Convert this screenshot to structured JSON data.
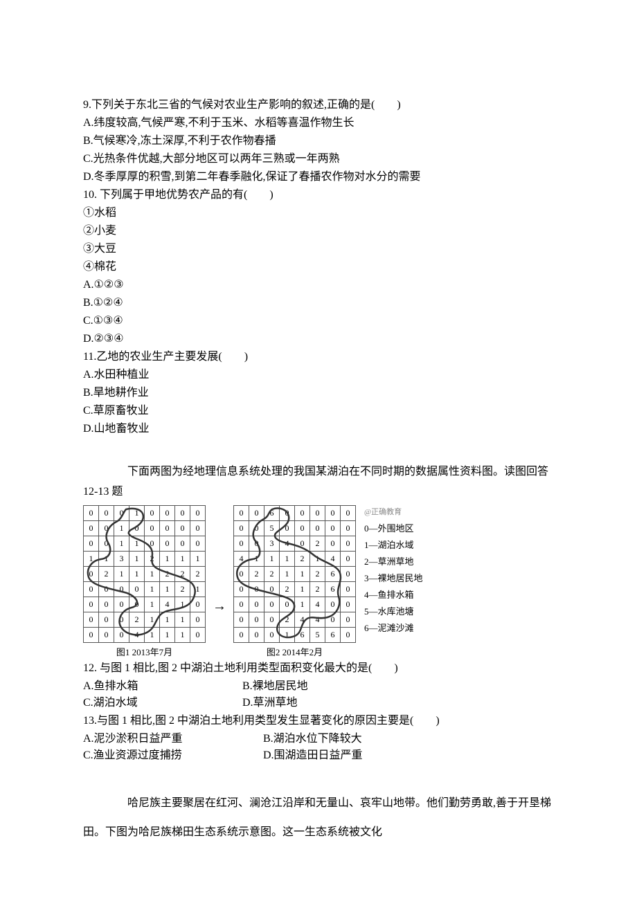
{
  "q9": {
    "stem": "9.下列关于东北三省的气候对农业生产影响的叙述,正确的是(　　)",
    "A": "A.纬度较高,气候严寒,不利于玉米、水稻等喜温作物生长",
    "B": "B.气候寒冷,冻土深厚,不利于农作物春播",
    "C": "C.光热条件优越,大部分地区可以两年三熟或一年两熟",
    "D": "D.冬季厚厚的积雪,到第二年春季融化,保证了春播农作物对水分的需要"
  },
  "q10": {
    "stem": "10. 下列属于甲地优势农产品的有(　　)",
    "i1": "①水稻",
    "i2": "②小麦",
    "i3": "③大豆",
    "i4": "④棉花",
    "A": "A.①②③",
    "B": "B.①②④",
    "C": "C.①③④",
    "D": "D.②③④"
  },
  "q11": {
    "stem": "11.乙地的农业生产主要发展(　　)",
    "A": "A.水田种植业",
    "B": "B.旱地耕作业",
    "C": "C.草原畜牧业",
    "D": "D.山地畜牧业"
  },
  "intro12": "下面两图为经地理信息系统处理的我国某湖泊在不同时期的数据属性资料图。读图回答 12-13 题",
  "figure": {
    "watermark": "@正确教育",
    "caption1": "图1  2013年7月",
    "caption2": "图2  2014年2月",
    "arrow": "→",
    "legend": {
      "l0": "0—外围地区",
      "l1": "1—湖泊水域",
      "l2": "2—草洲草地",
      "l3": "3—裸地居民地",
      "l4": "4—鱼排水箱",
      "l5": "5—水库池塘",
      "l6": "6—泥滩沙滩"
    }
  },
  "q12": {
    "stem": "12. 与图 1 相比,图 2 中湖泊土地利用类型面积变化最大的是(　　)",
    "A": "A.鱼排水箱",
    "B": "B.裸地居民地",
    "C": "C.湖泊水域",
    "D": "D.草洲草地"
  },
  "q13": {
    "stem": "13.与图 1 相比,图 2 中湖泊土地利用类型发生显著变化的原因主要是(　　)",
    "A": "A.泥沙淤积日益严重",
    "B": "B.湖泊水位下降较大",
    "C": "C.渔业资源过度捕捞",
    "D": "D.围湖造田日益严重"
  },
  "intro14": "哈尼族主要聚居在红河、澜沧江沿岸和无量山、哀牢山地带。他们勤劳勇敢,善于开垦梯田。下图为哈尼族梯田生态系统示意图。这一生态系统被文化",
  "chart_data": [
    {
      "type": "table",
      "title": "图1  2013年7月",
      "shape": [
        8,
        8
      ],
      "values": [
        [
          0,
          0,
          0,
          1,
          0,
          0,
          0,
          0
        ],
        [
          0,
          0,
          1,
          0,
          0,
          0,
          0,
          0
        ],
        [
          0,
          0,
          1,
          1,
          0,
          0,
          0,
          0
        ],
        [
          1,
          1,
          3,
          1,
          2,
          1,
          1,
          1
        ],
        [
          0,
          2,
          1,
          1,
          1,
          2,
          2,
          2
        ],
        [
          0,
          0,
          0,
          0,
          1,
          1,
          2,
          1
        ],
        [
          0,
          0,
          0,
          0,
          1,
          4,
          1,
          0
        ],
        [
          0,
          0,
          0,
          2,
          1,
          1,
          1,
          0
        ],
        [
          0,
          0,
          0,
          4,
          1,
          1,
          1,
          0
        ]
      ]
    },
    {
      "type": "table",
      "title": "图2  2014年2月",
      "shape": [
        8,
        8
      ],
      "values": [
        [
          0,
          0,
          6,
          0,
          0,
          0,
          0,
          0
        ],
        [
          0,
          0,
          5,
          0,
          0,
          0,
          0,
          0
        ],
        [
          0,
          0,
          3,
          4,
          0,
          2,
          0,
          0
        ],
        [
          4,
          1,
          1,
          1,
          2,
          1,
          4,
          0
        ],
        [
          0,
          2,
          2,
          1,
          1,
          2,
          6,
          0
        ],
        [
          0,
          0,
          0,
          2,
          1,
          2,
          6,
          0
        ],
        [
          0,
          0,
          0,
          0,
          1,
          4,
          0,
          0
        ],
        [
          0,
          0,
          0,
          2,
          4,
          4,
          0,
          0
        ],
        [
          0,
          0,
          0,
          1,
          6,
          5,
          6,
          0
        ]
      ]
    }
  ]
}
